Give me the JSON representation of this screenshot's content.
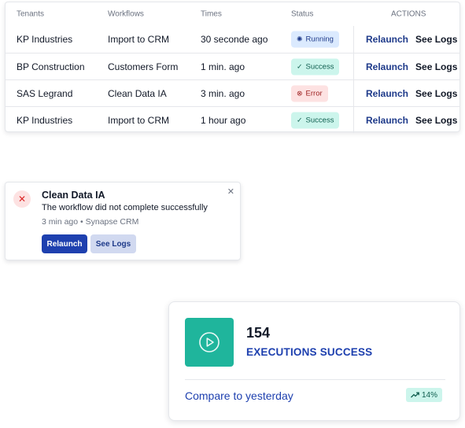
{
  "table": {
    "headers": {
      "tenants": "Tenants",
      "workflows": "Workflows",
      "times": "Times",
      "status": "Status",
      "actions": "ACTIONS"
    },
    "rows": [
      {
        "tenant": "KP Industries",
        "workflow": "Import to CRM",
        "time": "30 seconde ago",
        "status": "Running",
        "status_type": "running",
        "relaunch": "Relaunch",
        "logs": "See Logs"
      },
      {
        "tenant": "BP Construction",
        "workflow": "Customers Form",
        "time": "1 min. ago",
        "status": "Success",
        "status_type": "success",
        "relaunch": "Relaunch",
        "logs": "See Logs"
      },
      {
        "tenant": "SAS Legrand",
        "workflow": "Clean Data IA",
        "time": "3 min. ago",
        "status": "Error",
        "status_type": "error",
        "relaunch": "Relaunch",
        "logs": "See Logs"
      },
      {
        "tenant": "KP Industries",
        "workflow": "Import to CRM",
        "time": "1 hour ago",
        "status": "Success",
        "status_type": "success",
        "relaunch": "Relaunch",
        "logs": "See Logs"
      }
    ]
  },
  "toast": {
    "icon": "close-circle-icon",
    "title": "Clean Data IA",
    "message": "The workflow did not complete successfully",
    "meta": "3 min ago • Synapse CRM",
    "relaunch_label": "Relaunch",
    "logs_label": "See Logs"
  },
  "stat": {
    "icon": "play-icon",
    "value": "154",
    "label": "EXECUTIONS SUCCESS",
    "compare_label": "Compare to yesterday",
    "trend": "14%"
  },
  "colors": {
    "brand_blue": "#1e40af",
    "success_bg": "#ccf5ec",
    "error_bg": "#fde2e2",
    "running_bg": "#dbeafe",
    "teal": "#1fb59c"
  }
}
